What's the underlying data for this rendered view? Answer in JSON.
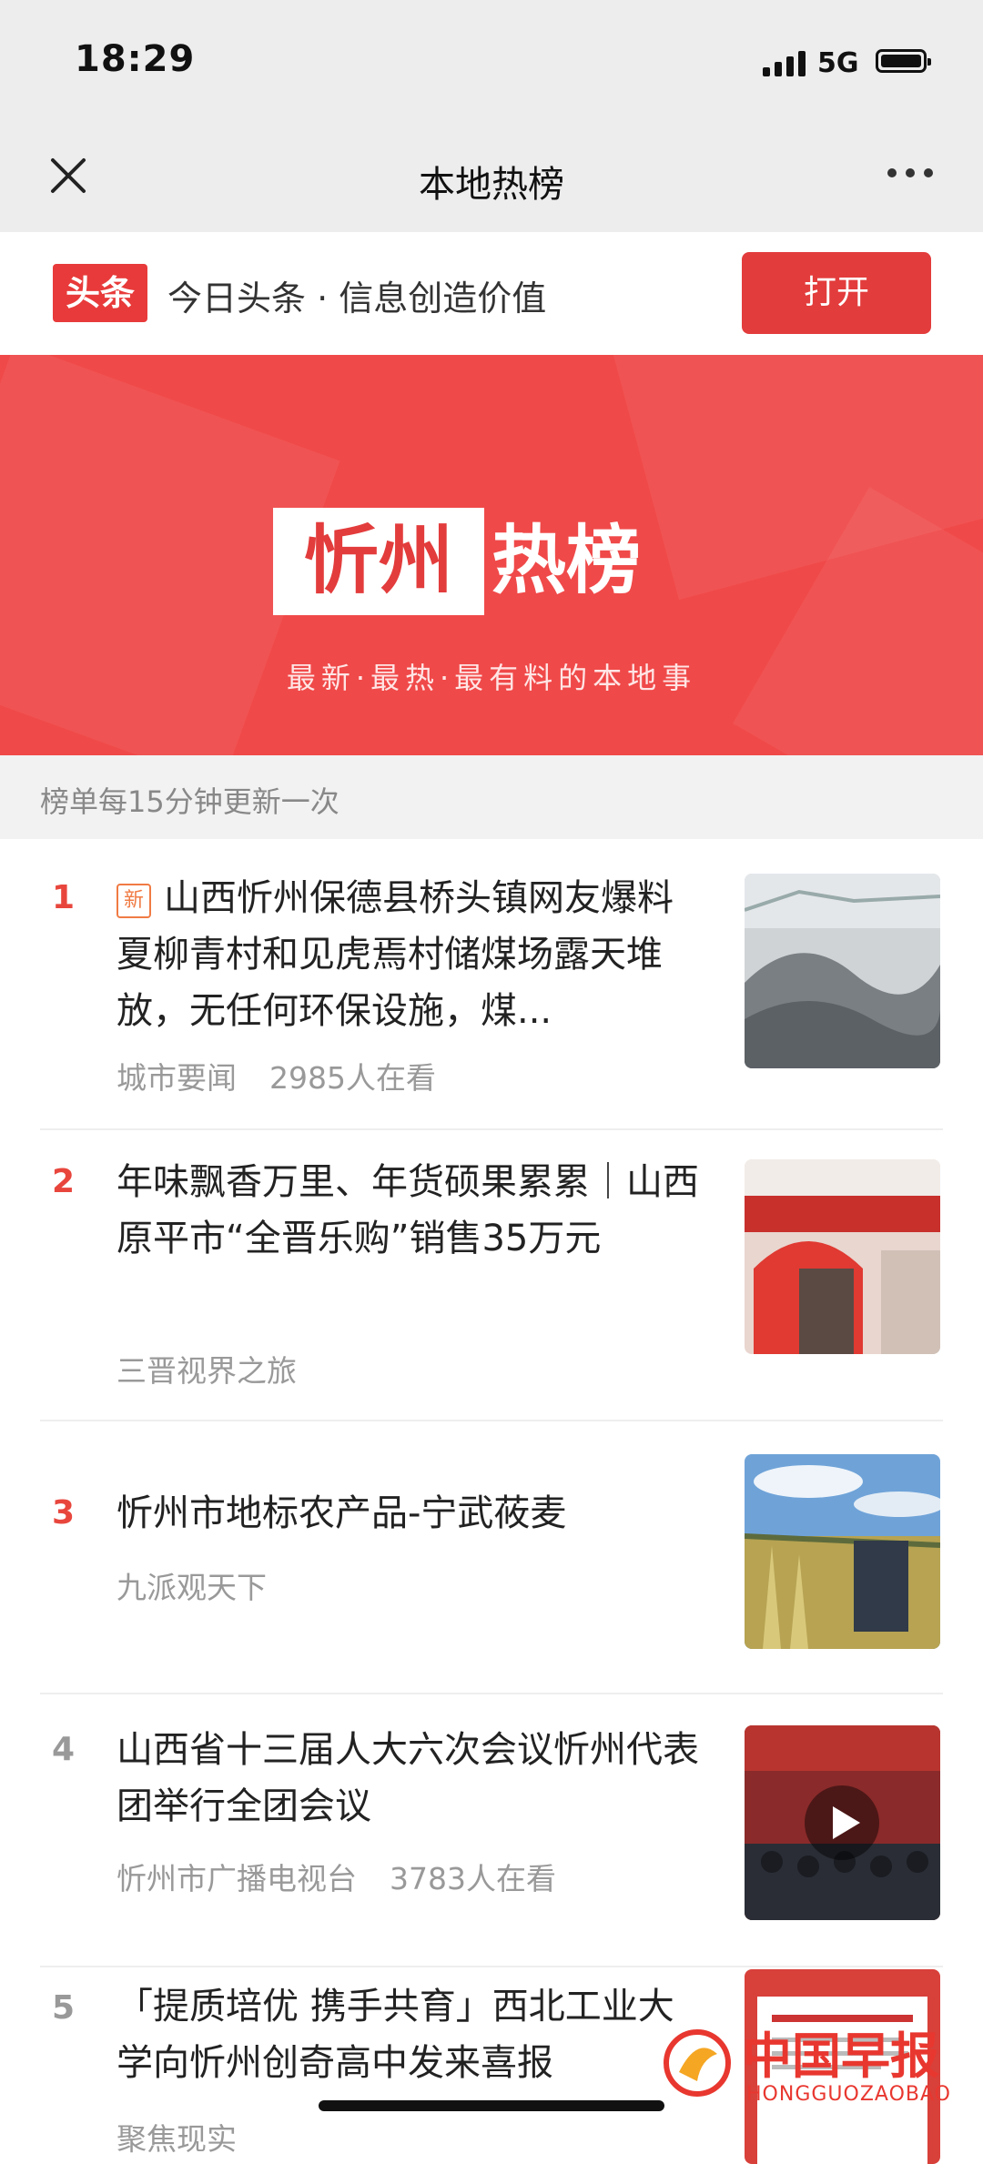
{
  "status_bar": {
    "time": "18:29",
    "network": "5G"
  },
  "nav": {
    "title": "本地热榜"
  },
  "app_bar": {
    "logo_text": "头条",
    "slogan": "今日头条 · 信息创造价值",
    "open_label": "打开"
  },
  "banner": {
    "word1": "忻州",
    "word2": "热榜",
    "subtitle": "最新·最热·最有料的本地事"
  },
  "update_note": "榜单每15分钟更新一次",
  "items": [
    {
      "rank": "1",
      "tag": "新",
      "title": "山西忻州保德县桥头镇网友爆料夏柳青村和见虎焉村储煤场露天堆放，无任何环保设施，煤...",
      "source": "城市要闻",
      "views": "2985人在看"
    },
    {
      "rank": "2",
      "title": "年味飘香万里、年货硕果累累｜山西原平市“全晋乐购”销售35万元",
      "source": "三晋视界之旅"
    },
    {
      "rank": "3",
      "title": "忻州市地标农产品-宁武莜麦",
      "source": "九派观天下"
    },
    {
      "rank": "4",
      "title": "山西省十三届人大六次会议忻州代表团举行全团会议",
      "source": "忻州市广播电视台",
      "views": "3783人在看"
    },
    {
      "rank": "5",
      "title": "「提质培优 携手共育」西北工业大学向忻州创奇高中发来喜报",
      "source": "聚焦现实"
    }
  ],
  "watermark": {
    "cn": "中国早报",
    "en": "HONGGUOZAOBAO"
  },
  "colors": {
    "accent": "#e33c3c",
    "banner": "#f04949",
    "rank_top": "#e8463d",
    "rank_normal": "#999999"
  }
}
